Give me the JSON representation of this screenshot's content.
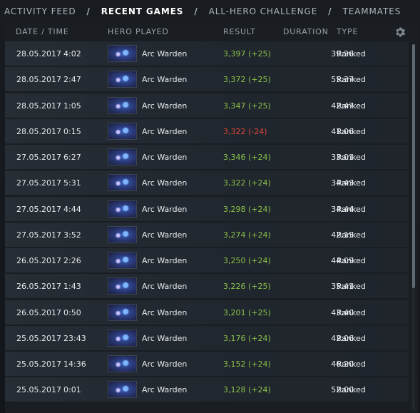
{
  "nav": {
    "tabs": [
      {
        "label": "ACTIVITY FEED",
        "active": false
      },
      {
        "label": "RECENT GAMES",
        "active": true
      },
      {
        "label": "ALL-HERO CHALLENGE",
        "active": false
      },
      {
        "label": "TEAMMATES",
        "active": false
      }
    ],
    "separator": "/"
  },
  "table": {
    "columns": {
      "date_time": "DATE / TIME",
      "hero": "HERO PLAYED",
      "result": "RESULT",
      "duration": "DURATION",
      "type": "TYPE"
    },
    "settings_icon": "gear-icon",
    "rows": [
      {
        "date": "28.05.2017",
        "time": "4:02",
        "hero": "Arc Warden",
        "result": "3,397 (+25)",
        "outcome": "win",
        "duration": "39:26",
        "type": "Ranked"
      },
      {
        "date": "28.05.2017",
        "time": "2:47",
        "hero": "Arc Warden",
        "result": "3,372 (+25)",
        "outcome": "win",
        "duration": "55:37",
        "type": "Ranked"
      },
      {
        "date": "28.05.2017",
        "time": "1:05",
        "hero": "Arc Warden",
        "result": "3,347 (+25)",
        "outcome": "win",
        "duration": "42:47",
        "type": "Ranked"
      },
      {
        "date": "28.05.2017",
        "time": "0:15",
        "hero": "Arc Warden",
        "result": "3,322 (-24)",
        "outcome": "loss",
        "duration": "41:06",
        "type": "Ranked"
      },
      {
        "date": "27.05.2017",
        "time": "6:27",
        "hero": "Arc Warden",
        "result": "3,346 (+24)",
        "outcome": "win",
        "duration": "33:01",
        "type": "Ranked"
      },
      {
        "date": "27.05.2017",
        "time": "5:31",
        "hero": "Arc Warden",
        "result": "3,322 (+24)",
        "outcome": "win",
        "duration": "34:43",
        "type": "Ranked"
      },
      {
        "date": "27.05.2017",
        "time": "4:44",
        "hero": "Arc Warden",
        "result": "3,298 (+24)",
        "outcome": "win",
        "duration": "34:44",
        "type": "Ranked"
      },
      {
        "date": "27.05.2017",
        "time": "3:52",
        "hero": "Arc Warden",
        "result": "3,274 (+24)",
        "outcome": "win",
        "duration": "42:15",
        "type": "Ranked"
      },
      {
        "date": "26.05.2017",
        "time": "2:26",
        "hero": "Arc Warden",
        "result": "3,250 (+24)",
        "outcome": "win",
        "duration": "44:09",
        "type": "Ranked"
      },
      {
        "date": "26.05.2017",
        "time": "1:43",
        "hero": "Arc Warden",
        "result": "3,226 (+25)",
        "outcome": "win",
        "duration": "35:41",
        "type": "Ranked"
      },
      {
        "date": "26.05.2017",
        "time": "0:50",
        "hero": "Arc Warden",
        "result": "3,201 (+25)",
        "outcome": "win",
        "duration": "43:40",
        "type": "Ranked"
      },
      {
        "date": "25.05.2017",
        "time": "23:43",
        "hero": "Arc Warden",
        "result": "3,176 (+24)",
        "outcome": "win",
        "duration": "42:06",
        "type": "Ranked"
      },
      {
        "date": "25.05.2017",
        "time": "14:36",
        "hero": "Arc Warden",
        "result": "3,152 (+24)",
        "outcome": "win",
        "duration": "46:20",
        "type": "Ranked"
      },
      {
        "date": "25.05.2017",
        "time": "0:01",
        "hero": "Arc Warden",
        "result": "3,128 (+24)",
        "outcome": "win",
        "duration": "52:00",
        "type": "Ranked"
      }
    ]
  },
  "colors": {
    "win": "#8bc34a",
    "loss": "#e0453a",
    "row_bg": "#232a31",
    "panel_bg": "#1a1e23"
  }
}
